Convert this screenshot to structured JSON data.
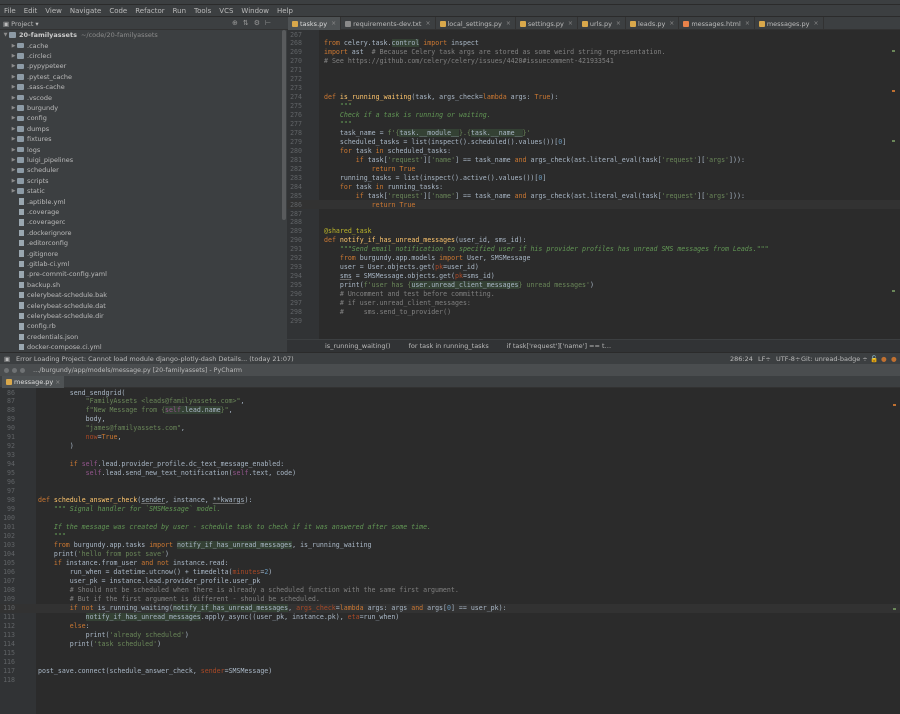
{
  "window": {
    "title": "",
    "second_title": "…/burgundy/app/models/message.py [20-familyassets] - PyCharm"
  },
  "menu": [
    "File",
    "Edit",
    "View",
    "Navigate",
    "Code",
    "Refactor",
    "Run",
    "Tools",
    "VCS",
    "Window",
    "Help"
  ],
  "project_button": "Project",
  "tabs": [
    {
      "label": "tasks.py",
      "active": true
    },
    {
      "label": "requirements-dev.txt",
      "active": false
    },
    {
      "label": "local_settings.py",
      "active": false
    },
    {
      "label": "settings.py",
      "active": false
    },
    {
      "label": "urls.py",
      "active": false
    },
    {
      "label": "leads.py",
      "active": false
    },
    {
      "label": "messages.html",
      "active": false
    },
    {
      "label": "messages.py",
      "active": false
    }
  ],
  "tree": {
    "root": "20-familyassets",
    "root_path": "~/code/20-familyassets",
    "folders": [
      ".cache",
      ".circleci",
      ".pypypeteer",
      ".pytest_cache",
      ".sass-cache",
      ".vscode",
      "burgundy",
      "config",
      "dumps",
      "fixtures",
      "logs",
      "luigi_pipelines",
      "scheduler",
      "scripts",
      "static"
    ],
    "files": [
      ".aptible.yml",
      ".coverage",
      ".coveragerc",
      ".dockerignore",
      ".editorconfig",
      ".gitignore",
      ".gitlab-ci.yml",
      ".pre-commit-config.yaml",
      "backup.sh",
      "celerybeat-schedule.bak",
      "celerybeat-schedule.dat",
      "celerybeat-schedule.dir",
      "config.rb",
      "credentials.json",
      "docker-compose.ci.yml"
    ]
  },
  "editor1": {
    "lines": [
      {
        "n": "267",
        "h": ""
      },
      {
        "n": "268",
        "h": "<span class=\"kw\">from</span> celery.task.<span class=\"hl\">control</span> <span class=\"kw\">import</span> inspect"
      },
      {
        "n": "269",
        "h": "<span class=\"kw\">import</span> ast  <span class=\"cmt\"># Because Celery task args are stored as some weird string representation.</span>"
      },
      {
        "n": "270",
        "h": "<span class=\"cmt\"># See https://github.com/celery/celery/issues/4420#issuecomment-421933541</span>"
      },
      {
        "n": "271",
        "h": ""
      },
      {
        "n": "272",
        "h": ""
      },
      {
        "n": "273",
        "h": ""
      },
      {
        "n": "274",
        "h": "<span class=\"kw\">def</span> <span class=\"fn\">is_running_waiting</span>(task, args_check=<span class=\"kw\">lambda</span> args: <span class=\"kw\">True</span>):"
      },
      {
        "n": "275",
        "h": "    <span class=\"doc\">\"\"\"</span>"
      },
      {
        "n": "276",
        "h": "    <span class=\"doc\">Check if a task is running or waiting.</span>"
      },
      {
        "n": "277",
        "h": "    <span class=\"doc\">\"\"\"</span>"
      },
      {
        "n": "278",
        "h": "    task_name = <span class=\"str\">f'{</span><span class=\"hl\">task.__module__</span><span class=\"str\">}.{</span><span class=\"hl\">task.__name__</span><span class=\"str\">}'</span>"
      },
      {
        "n": "279",
        "h": "    scheduled_tasks = list(inspect().scheduled().values())[<span class=\"num\">0</span>]"
      },
      {
        "n": "280",
        "h": "    <span class=\"kw\">for</span> task <span class=\"kw\">in</span> scheduled_tasks:"
      },
      {
        "n": "281",
        "h": "        <span class=\"kw\">if</span> task[<span class=\"str\">'request'</span>][<span class=\"str\">'name'</span>] == task_name <span class=\"kw\">and</span> args_check(ast.literal_eval(task[<span class=\"str\">'request'</span>][<span class=\"str\">'args'</span>])):"
      },
      {
        "n": "282",
        "h": "            <span class=\"kw\">return True</span>"
      },
      {
        "n": "283",
        "h": "    running_tasks = list(inspect().active().values())[<span class=\"num\">0</span>]"
      },
      {
        "n": "284",
        "h": "    <span class=\"kw\">for</span> task <span class=\"kw\">in</span> running_tasks:"
      },
      {
        "n": "285",
        "h": "        <span class=\"kw\">if</span> task[<span class=\"str\">'request'</span>][<span class=\"str\">'name'</span>] == task_name <span class=\"kw\">and</span> args_check(ast.literal_eval(task[<span class=\"str\">'request'</span>][<span class=\"str\">'args'</span>])):"
      },
      {
        "n": "286",
        "h": "            <span class=\"kw\">return True</span>"
      },
      {
        "n": "287",
        "h": ""
      },
      {
        "n": "288",
        "h": ""
      },
      {
        "n": "289",
        "h": "<span class=\"dec\">@shared_task</span>"
      },
      {
        "n": "290",
        "h": "<span class=\"kw\">def</span> <span class=\"fn\">notify_if_has_unread_messages</span>(user_id, sms_id):"
      },
      {
        "n": "291",
        "h": "    <span class=\"doc\">\"\"\"Send email notification to specified user if his provider profiles has unread SMS messages from Leads.\"\"\"</span>"
      },
      {
        "n": "292",
        "h": "    <span class=\"kw\">from</span> burgundy.app.models <span class=\"kw\">import</span> User, SMSMessage"
      },
      {
        "n": "293",
        "h": "    user = User.objects.get(<span class=\"prm\">pk</span>=user_id)"
      },
      {
        "n": "294",
        "h": "    <span class=\"ul\">sms</span> = SMSMessage.objects.get(<span class=\"prm\">pk</span>=sms_id)"
      },
      {
        "n": "295",
        "h": "    print(<span class=\"str\">f'user has {</span><span class=\"hl\">user.unread_client_messages</span><span class=\"str\">} unread messages'</span>)"
      },
      {
        "n": "296",
        "h": "    <span class=\"cmt\"># Uncomment and test before committing.</span>"
      },
      {
        "n": "297",
        "h": "    <span class=\"cmt\"># if user.unread_client_messages:</span>"
      },
      {
        "n": "298",
        "h": "    <span class=\"cmt\">#     sms.send_to_provider()</span>"
      },
      {
        "n": "299",
        "h": ""
      }
    ]
  },
  "breadcrumb1": [
    "is_running_waiting()",
    "for task in running_tasks",
    "if task['request']['name'] == t…"
  ],
  "status": {
    "message": "Error Loading Project: Cannot load module django-plotly-dash Details... (today 21:07)",
    "position": "286:24",
    "line_sep": "LF÷",
    "encoding": "UTF-8÷",
    "git": "Git: unread-badge ÷"
  },
  "tab2": {
    "label": "message.py"
  },
  "editor2": {
    "lines": [
      {
        "n": "86",
        "h": "        send_sendgrid("
      },
      {
        "n": "87",
        "h": "            <span class=\"str\">\"FamilyAssets &lt;leads@familyassets.com&gt;\"</span>,"
      },
      {
        "n": "88",
        "h": "            <span class=\"str\">f\"New Message from {</span><span class=\"hl\"><span class=\"slf\">self</span>.lead.name</span><span class=\"str\">}\"</span>,"
      },
      {
        "n": "89",
        "h": "            body,"
      },
      {
        "n": "90",
        "h": "            <span class=\"str\">\"james@familyassets.com\"</span>,"
      },
      {
        "n": "91",
        "h": "            <span class=\"prm\">now</span>=<span class=\"kw\">True</span>,"
      },
      {
        "n": "92",
        "h": "        )"
      },
      {
        "n": "93",
        "h": ""
      },
      {
        "n": "94",
        "h": "        <span class=\"kw\">if</span> <span class=\"slf\">self</span>.lead.provider_profile.dc_text_message_enabled:"
      },
      {
        "n": "95",
        "h": "            <span class=\"slf\">self</span>.lead.send_new_text_notification(<span class=\"slf\">self</span>.text, code)"
      },
      {
        "n": "96",
        "h": ""
      },
      {
        "n": "97",
        "h": ""
      },
      {
        "n": "98",
        "h": "<span class=\"kw\">def</span> <span class=\"fn\">schedule_answer_check</span>(<span class=\"ul\">sender</span>, instance, <span class=\"ul\">**kwargs</span>):"
      },
      {
        "n": "99",
        "h": "    <span class=\"doc\">\"\"\" Signal handler for `SMSMessage` model.</span>"
      },
      {
        "n": "100",
        "h": ""
      },
      {
        "n": "101",
        "h": "    <span class=\"doc\">If the message was created by user - schedule task to check if it was answered after some time.</span>"
      },
      {
        "n": "102",
        "h": "    <span class=\"doc\">\"\"\"</span>"
      },
      {
        "n": "103",
        "h": "    <span class=\"kw\">from</span> burgundy.app.tasks <span class=\"kw\">import</span> <span class=\"hl\">notify_if_has_unread_messages</span>, is_running_waiting"
      },
      {
        "n": "104",
        "h": "    print(<span class=\"str\">'hello from post save'</span>)"
      },
      {
        "n": "105",
        "h": "    <span class=\"kw\">if</span> instance.from_user <span class=\"kw\">and not</span> instance.read:"
      },
      {
        "n": "106",
        "h": "        run_when = datetime.utcnow() + timedelta(<span class=\"prm\">minutes</span>=<span class=\"num\">2</span>)"
      },
      {
        "n": "107",
        "h": "        user_pk = instance.lead.provider_profile.user_pk"
      },
      {
        "n": "108",
        "h": "        <span class=\"cmt\"># Should not be scheduled when there is already a scheduled function with the same first argument.</span>"
      },
      {
        "n": "109",
        "h": "        <span class=\"cmt\"># But if the first argument is different - should be scheduled.</span>"
      },
      {
        "n": "110",
        "h": "        <span class=\"kw\">if not</span> is_running_waiting(<span class=\"hl\">notify_if_has_unread_messages</span>, <span class=\"prm\">args_check</span>=<span class=\"kw\">lambda</span> args: args <span class=\"kw\">and</span> args[<span class=\"num\">0</span>] == user_pk):"
      },
      {
        "n": "111",
        "h": "            <span class=\"hl\">notify_if_has_unread_messages</span>.apply_async((user_pk, instance.pk), <span class=\"prm\">eta</span>=run_when)"
      },
      {
        "n": "112",
        "h": "        <span class=\"kw\">else</span>:"
      },
      {
        "n": "113",
        "h": "            print(<span class=\"str\">'already scheduled'</span>)"
      },
      {
        "n": "114",
        "h": "        print(<span class=\"str\">'task scheduled'</span>)"
      },
      {
        "n": "115",
        "h": ""
      },
      {
        "n": "116",
        "h": ""
      },
      {
        "n": "117",
        "h": "post_save.connect(schedule_answer_check, <span class=\"prm\">sender</span>=SMSMessage)"
      },
      {
        "n": "118",
        "h": ""
      }
    ]
  }
}
